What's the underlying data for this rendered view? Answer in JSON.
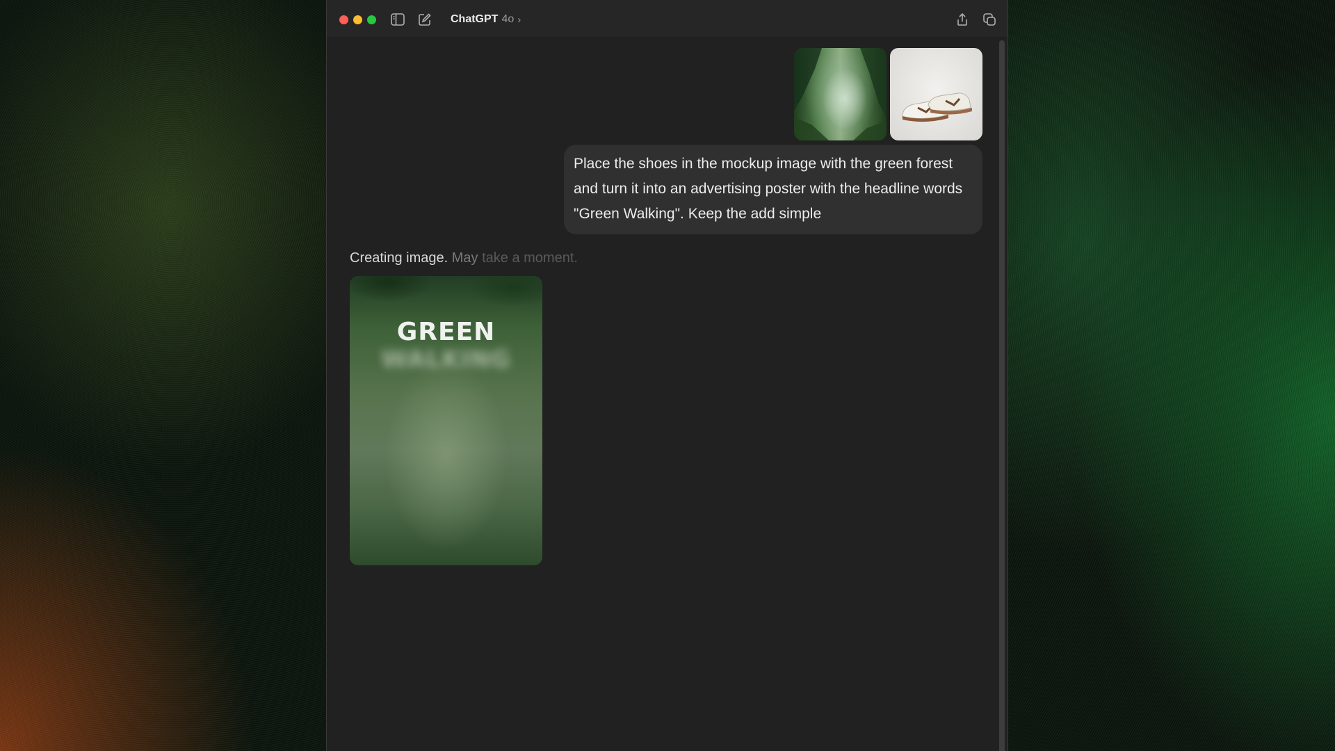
{
  "window": {
    "model_name": "ChatGPT",
    "model_version": "4o",
    "model_chevron": "›"
  },
  "conversation": {
    "user_message": "Place the shoes in the mockup image with the green forest and turn it into an advertising poster with the headline words \"Green Walking\". Keep the add simple",
    "status_part1": "Creating image.",
    "status_part2": " May",
    "status_part3": " take a moment.",
    "generated_headline_1": "GREEN",
    "generated_headline_2": "WALKING"
  },
  "icons": {
    "sidebar_toggle": "sidebar-icon",
    "new_chat": "compose-icon",
    "share": "share-icon",
    "popout": "new-window-icon"
  },
  "colors": {
    "window_bg": "#212121",
    "bubble_bg": "#303030",
    "close": "#ff5f57",
    "minimize": "#febc2e",
    "maximize": "#28c840"
  }
}
